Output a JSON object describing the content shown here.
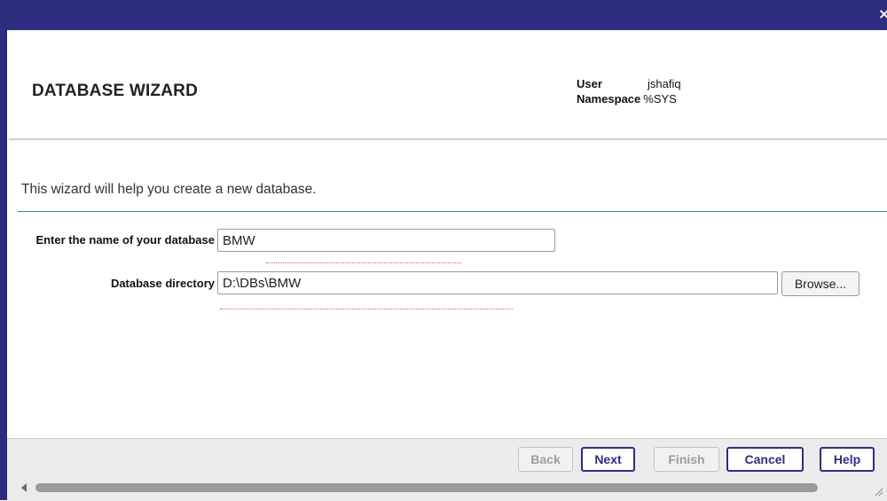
{
  "window": {
    "close_glyph": "×"
  },
  "header": {
    "title": "DATABASE WIZARD",
    "user_label": "User",
    "user_value": "jshafiq",
    "namespace_label": "Namespace",
    "namespace_value": "%SYS"
  },
  "intro": "This wizard will help you create a new database.",
  "form": {
    "db_name_label": "Enter the name of your database",
    "db_name_value": "BMW",
    "db_dir_label": "Database directory",
    "db_dir_value": "D:\\DBs\\BMW",
    "browse_label": "Browse..."
  },
  "footer": {
    "back_label": "Back",
    "next_label": "Next",
    "finish_label": "Finish",
    "cancel_label": "Cancel",
    "help_label": "Help"
  },
  "colors": {
    "titlebar": "#2e2e80",
    "accent_line": "#2a8a8a",
    "primary_button": "#2e2e80"
  }
}
